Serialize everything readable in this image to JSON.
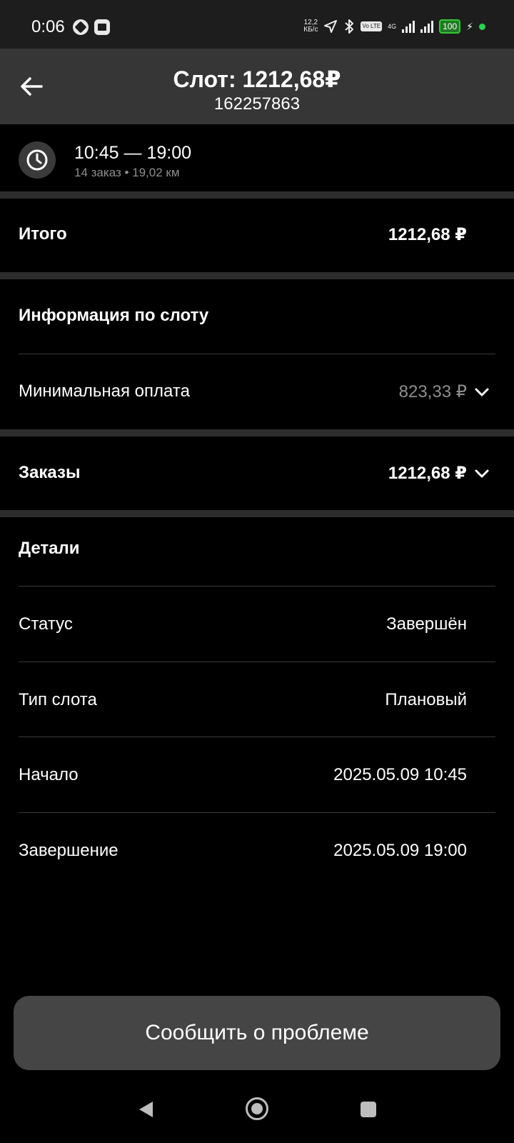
{
  "status_bar": {
    "time": "0:06",
    "speed_value": "12,2",
    "speed_unit": "КБ/с",
    "volte": "Vo LTE",
    "network": "4G",
    "battery": "100"
  },
  "header": {
    "title": "Слот: 1212,68₽",
    "subtitle": "162257863"
  },
  "slot": {
    "time_range": "10:45 — 19:00",
    "meta": "14 заказ • 19,02 км"
  },
  "total": {
    "label": "Итого",
    "value": "1212,68 ₽"
  },
  "slot_info": {
    "heading": "Информация по слоту",
    "min_payment_label": "Минимальная оплата",
    "min_payment_value": "823,33 ₽"
  },
  "orders": {
    "label": "Заказы",
    "value": "1212,68 ₽"
  },
  "details": {
    "heading": "Детали",
    "rows": [
      {
        "label": "Статус",
        "value": "Завершён"
      },
      {
        "label": "Тип слота",
        "value": "Плановый"
      },
      {
        "label": "Начало",
        "value": "2025.05.09 10:45"
      },
      {
        "label": "Завершение",
        "value": "2025.05.09 19:00"
      }
    ]
  },
  "report_button": "Сообщить о проблеме",
  "icons": {
    "back": "arrow-left-icon",
    "clock": "clock-icon",
    "chevron": "chevron-down-icon"
  },
  "colors": {
    "background": "#000000",
    "header_bg": "#363636",
    "separator": "#2c2c2c",
    "button_bg": "#454545",
    "muted_text": "#8e8e8e",
    "battery_green": "#39c33a"
  }
}
